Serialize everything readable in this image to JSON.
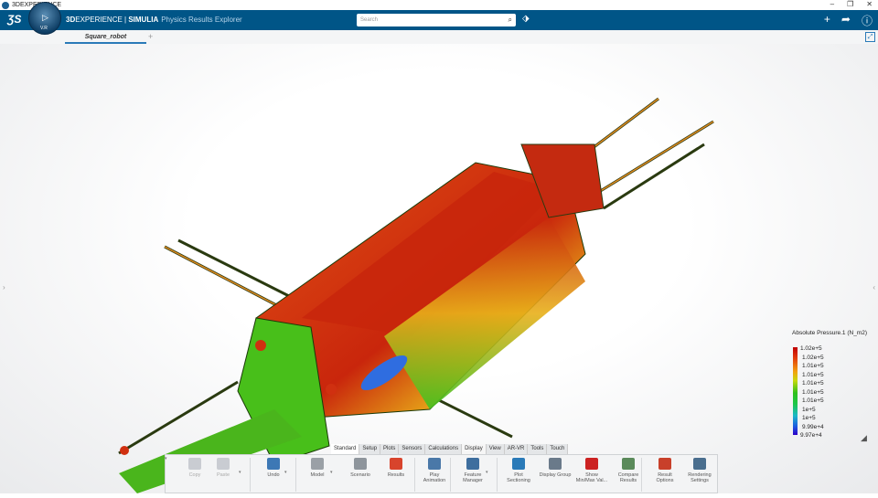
{
  "window": {
    "title": "3DEXPERIENCE",
    "controls": [
      "–",
      "❐",
      "✕"
    ]
  },
  "header": {
    "brand_bold": "3D",
    "brand_rest": "EXPERIENCE | ",
    "brand_simulia": "SIMULIA",
    "app_name": "Physics Results Explorer",
    "compass_label": "V.R",
    "search_placeholder": "Search"
  },
  "doc_tab": {
    "label": "Square_robot",
    "add": "+"
  },
  "legend": {
    "title": "Absolute Pressure.1 (N_m2)",
    "labels": [
      "1.02e+5",
      "1.02e+5",
      "1.01e+5",
      "1.01e+5",
      "1.01e+5",
      "1.01e+5",
      "1.01e+5",
      "1e+5",
      "1e+5",
      "9.99e+4",
      "9.97e+4"
    ]
  },
  "ribbon_tabs": [
    "Standard",
    "Setup",
    "Plots",
    "Sensors",
    "Calculations",
    "Display",
    "View",
    "AR-VR",
    "Tools",
    "Touch"
  ],
  "toolbar": [
    {
      "label": "Copy",
      "color": "#c9ccd2"
    },
    {
      "label": "Paste",
      "color": "#c9ccd2"
    },
    {
      "label": "Undo",
      "color": "#3d78b5"
    },
    {
      "label": "Model",
      "color": "#9aa0a6"
    },
    {
      "label": "Scenario",
      "color": "#8e959c"
    },
    {
      "label": "Results",
      "color": "#d8442c"
    },
    {
      "label": "Play Animation",
      "color": "#4a78a8"
    },
    {
      "label": "Feature Manager",
      "color": "#3e6e9e"
    },
    {
      "label": "Plot Sectioning",
      "color": "#2a7ab8"
    },
    {
      "label": "Display Group",
      "color": "#6a7a8a"
    },
    {
      "label": "Show Min/Max Val...",
      "color": "#c22"
    },
    {
      "label": "Compare Results",
      "color": "#5a8a5a"
    },
    {
      "label": "Result Options",
      "color": "#c8402a"
    },
    {
      "label": "Rendering Settings",
      "color": "#4a6e8e"
    }
  ]
}
